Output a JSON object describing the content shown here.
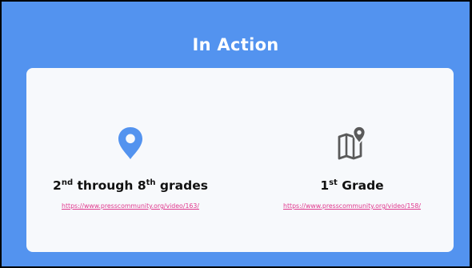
{
  "slide": {
    "title": "In Action",
    "colors": {
      "background": "#5393ef",
      "card": "#f7f9fc",
      "pin_icon": "#5393ef",
      "map_icon": "#5a5a5a",
      "link": "#e0378d"
    },
    "items": [
      {
        "icon": "location-pin-icon",
        "label": {
          "part1": "2",
          "sup1": "nd",
          "part2": " through 8",
          "sup2": "th",
          "part3": " grades"
        },
        "link": "https://www.presscommunity.org/video/163/"
      },
      {
        "icon": "map-pin-icon",
        "label": {
          "part1": "1",
          "sup1": "st",
          "part2": " Grade"
        },
        "link": "https://www.presscommunity.org/video/158/"
      }
    ]
  }
}
